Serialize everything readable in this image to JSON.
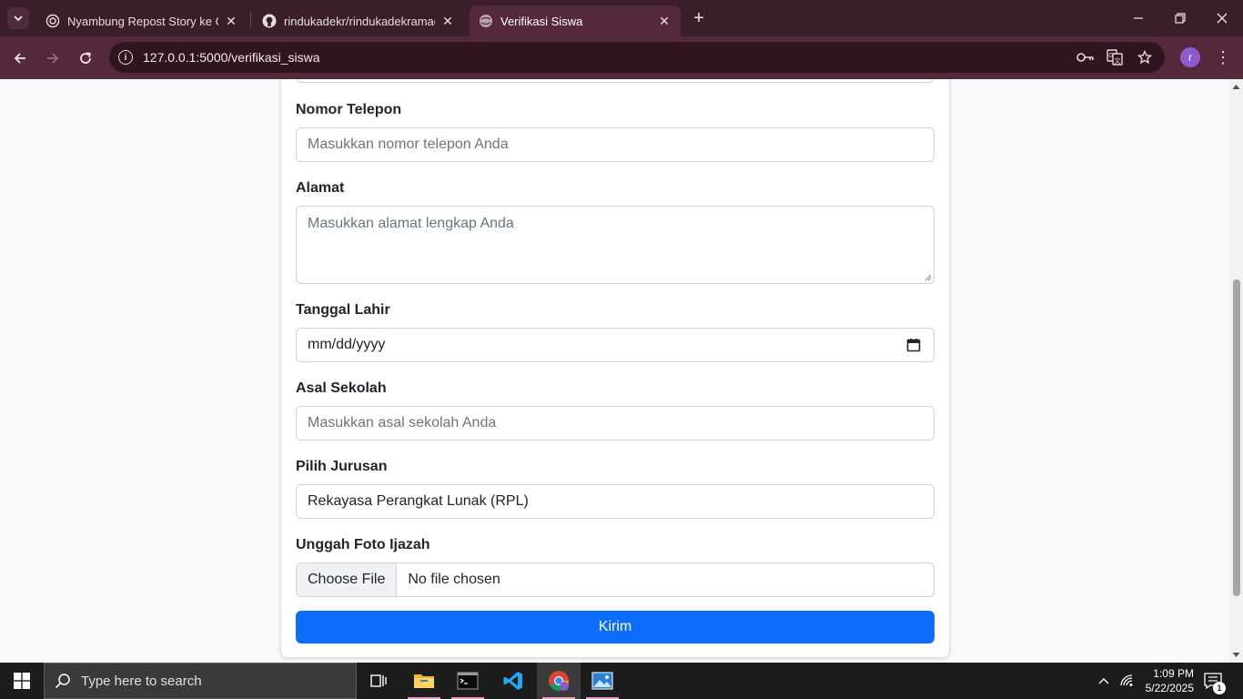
{
  "browser": {
    "tabs": [
      {
        "title": "Nyambung Repost Story ke GitH",
        "favicon": "openai-icon",
        "active": false
      },
      {
        "title": "rindukadekr/rindukadekramadh",
        "favicon": "github-icon",
        "active": false
      },
      {
        "title": "Verifikasi Siswa",
        "favicon": "globe-icon",
        "active": true
      }
    ],
    "url": "127.0.0.1:5000/verifikasi_siswa",
    "profile_initial": "r",
    "accent_color": "#55283c"
  },
  "form": {
    "fields": {
      "phone": {
        "label": "Nomor Telepon",
        "placeholder": "Masukkan nomor telepon Anda"
      },
      "address": {
        "label": "Alamat",
        "placeholder": "Masukkan alamat lengkap Anda"
      },
      "birthdate": {
        "label": "Tanggal Lahir",
        "value": "mm/dd/yyyy"
      },
      "school": {
        "label": "Asal Sekolah",
        "placeholder": "Masukkan asal sekolah Anda"
      },
      "major": {
        "label": "Pilih Jurusan",
        "value": "Rekayasa Perangkat Lunak (RPL)"
      },
      "diploma": {
        "label": "Unggah Foto Ijazah",
        "button": "Choose File",
        "status": "No file chosen"
      }
    },
    "submit_label": "Kirim",
    "submit_color": "#0d6efd"
  },
  "taskbar": {
    "search_placeholder": "Type here to search",
    "time": "1:09 PM",
    "date": "5/22/2025",
    "notification_count": "1"
  }
}
